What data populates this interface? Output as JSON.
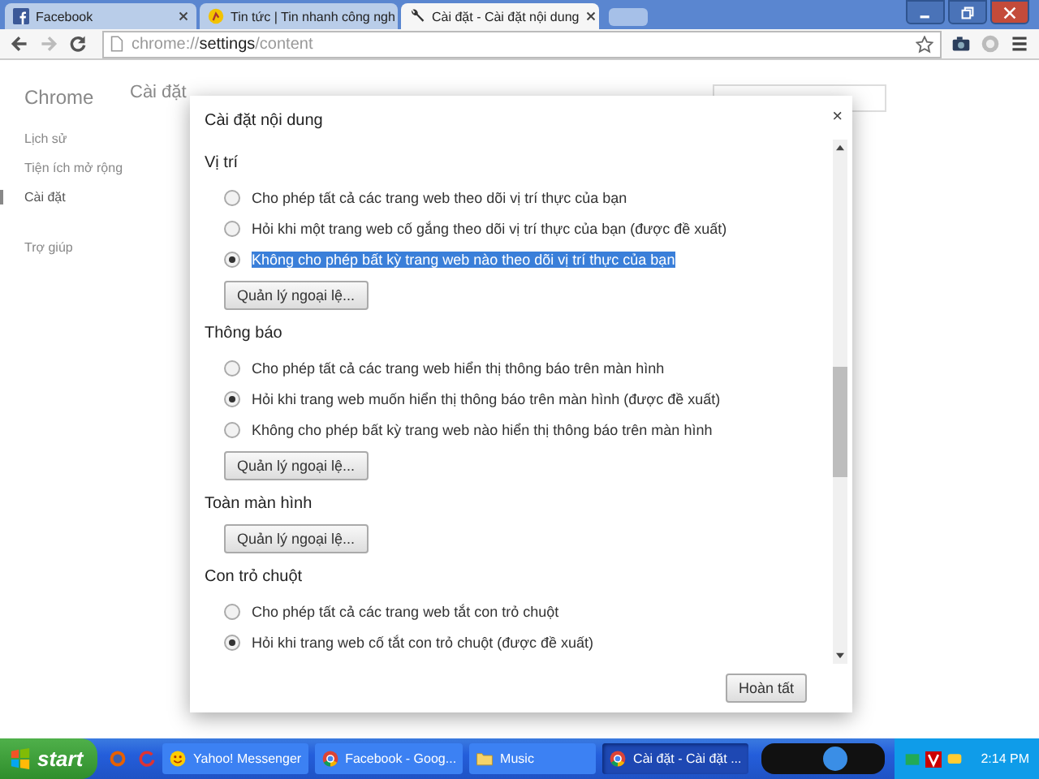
{
  "browser": {
    "tabs": [
      {
        "title": "Facebook",
        "selected": false
      },
      {
        "title": "Tin tức | Tin nhanh công ngh",
        "selected": false
      },
      {
        "title": "Cài đặt - Cài đặt nội dung",
        "selected": true
      }
    ],
    "address": {
      "scheme": "chrome://",
      "host": "settings",
      "path": "/content"
    }
  },
  "settings_page": {
    "sidebar_title": "Chrome",
    "heading": "Cài đặt",
    "sidebar_items": [
      {
        "label": "Lịch sử",
        "selected": false
      },
      {
        "label": "Tiện ích mở rộng",
        "selected": false
      },
      {
        "label": "Cài đặt",
        "selected": true
      },
      {
        "label": "Trợ giúp",
        "selected": false
      }
    ]
  },
  "dialog": {
    "title": "Cài đặt nội dung",
    "close": "×",
    "done_button": "Hoàn tất",
    "sections": [
      {
        "heading": "Vị trí",
        "options": [
          {
            "label": "Cho phép tất cả các trang web theo dõi vị trí thực của bạn",
            "selected": false,
            "text_selected": false
          },
          {
            "label": "Hỏi khi một trang web cố gắng theo dõi vị trí thực của bạn (được đề xuất)",
            "selected": false,
            "text_selected": false
          },
          {
            "label": "Không cho phép bất kỳ trang web nào theo dõi vị trí thực của bạn",
            "selected": true,
            "text_selected": true
          }
        ],
        "button": "Quản lý ngoại lệ..."
      },
      {
        "heading": "Thông báo",
        "options": [
          {
            "label": "Cho phép tất cả các trang web hiển thị thông báo trên màn hình",
            "selected": false,
            "text_selected": false
          },
          {
            "label": "Hỏi khi trang web muốn hiển thị thông báo trên màn hình (được đề xuất)",
            "selected": true,
            "text_selected": false
          },
          {
            "label": "Không cho phép bất kỳ trang web nào hiển thị thông báo trên màn hình",
            "selected": false,
            "text_selected": false
          }
        ],
        "button": "Quản lý ngoại lệ..."
      },
      {
        "heading": "Toàn màn hình",
        "button": "Quản lý ngoại lệ..."
      },
      {
        "heading": "Con trỏ chuột",
        "options": [
          {
            "label": "Cho phép tất cả các trang web tắt con trỏ chuột",
            "selected": false,
            "text_selected": false
          },
          {
            "label": "Hỏi khi trang web cố tắt con trỏ chuột (được đề xuất)",
            "selected": true,
            "text_selected": false
          }
        ]
      }
    ]
  },
  "taskbar": {
    "start": "start",
    "tasks": [
      {
        "label": "Yahoo! Messenger",
        "selected": false
      },
      {
        "label": "Facebook - Goog...",
        "selected": false
      },
      {
        "label": "Music",
        "selected": false
      },
      {
        "label": "Cài đặt - Cài đặt ...",
        "selected": true
      }
    ],
    "clock": "2:14 PM"
  }
}
